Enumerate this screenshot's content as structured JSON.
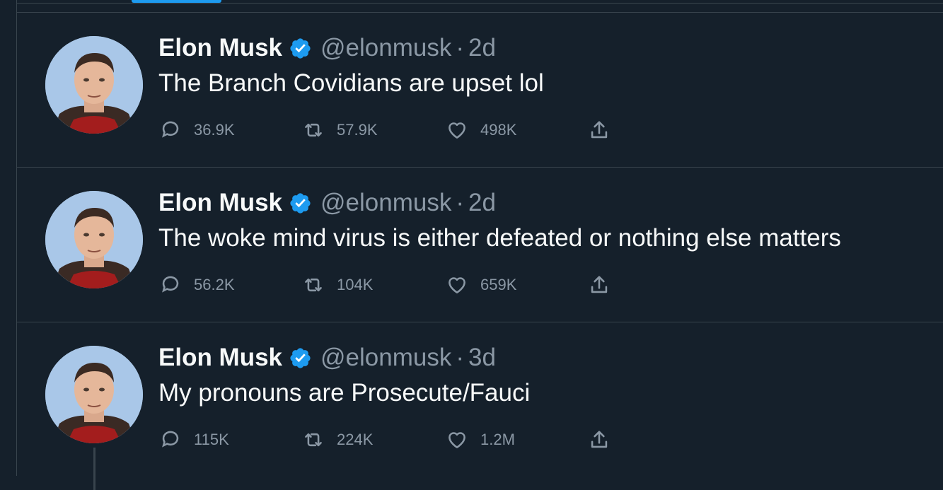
{
  "tweets": [
    {
      "author_name": "Elon Musk",
      "handle": "@elonmusk",
      "separator": "·",
      "time": "2d",
      "text": "The Branch Covidians are upset lol",
      "replies": "36.9K",
      "retweets": "57.9K",
      "likes": "498K"
    },
    {
      "author_name": "Elon Musk",
      "handle": "@elonmusk",
      "separator": "·",
      "time": "2d",
      "text": "The woke mind virus is either defeated or nothing else matters",
      "replies": "56.2K",
      "retweets": "104K",
      "likes": "659K"
    },
    {
      "author_name": "Elon Musk",
      "handle": "@elonmusk",
      "separator": "·",
      "time": "3d",
      "text": "My pronouns are Prosecute/Fauci",
      "replies": "115K",
      "retweets": "224K",
      "likes": "1.2M"
    }
  ],
  "icons": {
    "verified": "verified-badge-icon",
    "reply": "reply-icon",
    "retweet": "retweet-icon",
    "like": "heart-icon",
    "share": "share-icon"
  },
  "colors": {
    "background": "#15202b",
    "border": "#38444d",
    "accent": "#1d9bf0",
    "text_primary": "#f7f9f9",
    "text_secondary": "#8b98a5"
  }
}
